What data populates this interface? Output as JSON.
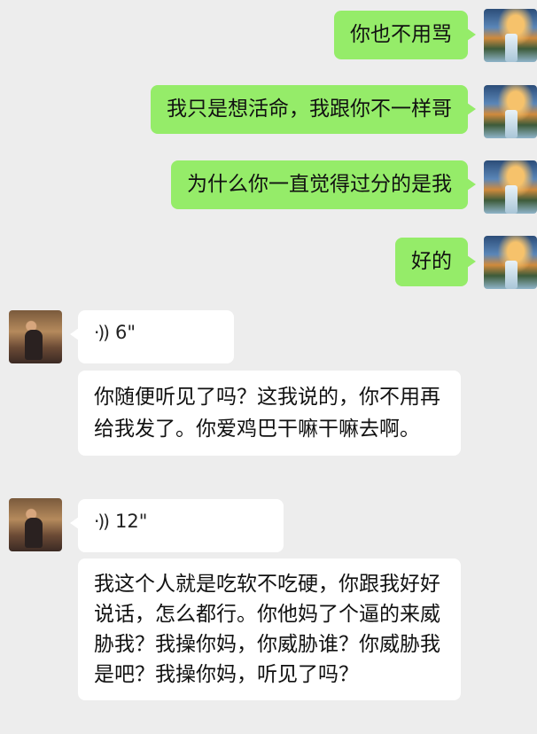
{
  "messages": [
    {
      "text": "你也不用骂"
    },
    {
      "text": "我只是想活命，我跟你不一样哥"
    },
    {
      "text": "为什么你一直觉得过分的是我"
    },
    {
      "text": "好的"
    },
    {
      "voice_icon": "voice-wave-icon",
      "duration": "6\""
    },
    {
      "text": "你随便听见了吗？这我说的，你不用再给我发了。你爱鸡巴干嘛干嘛去啊。"
    },
    {
      "voice_icon": "voice-wave-icon",
      "duration": "12\""
    },
    {
      "text": "我这个人就是吃软不吃硬，你跟我好好说话，怎么都行。你他妈了个逼的来威胁我？我操你妈，你威胁谁？你威胁我是吧？我操你妈，听见了吗？"
    }
  ],
  "colors": {
    "outgoing": "#95ec69",
    "incoming": "#ffffff",
    "background": "#ededed"
  }
}
